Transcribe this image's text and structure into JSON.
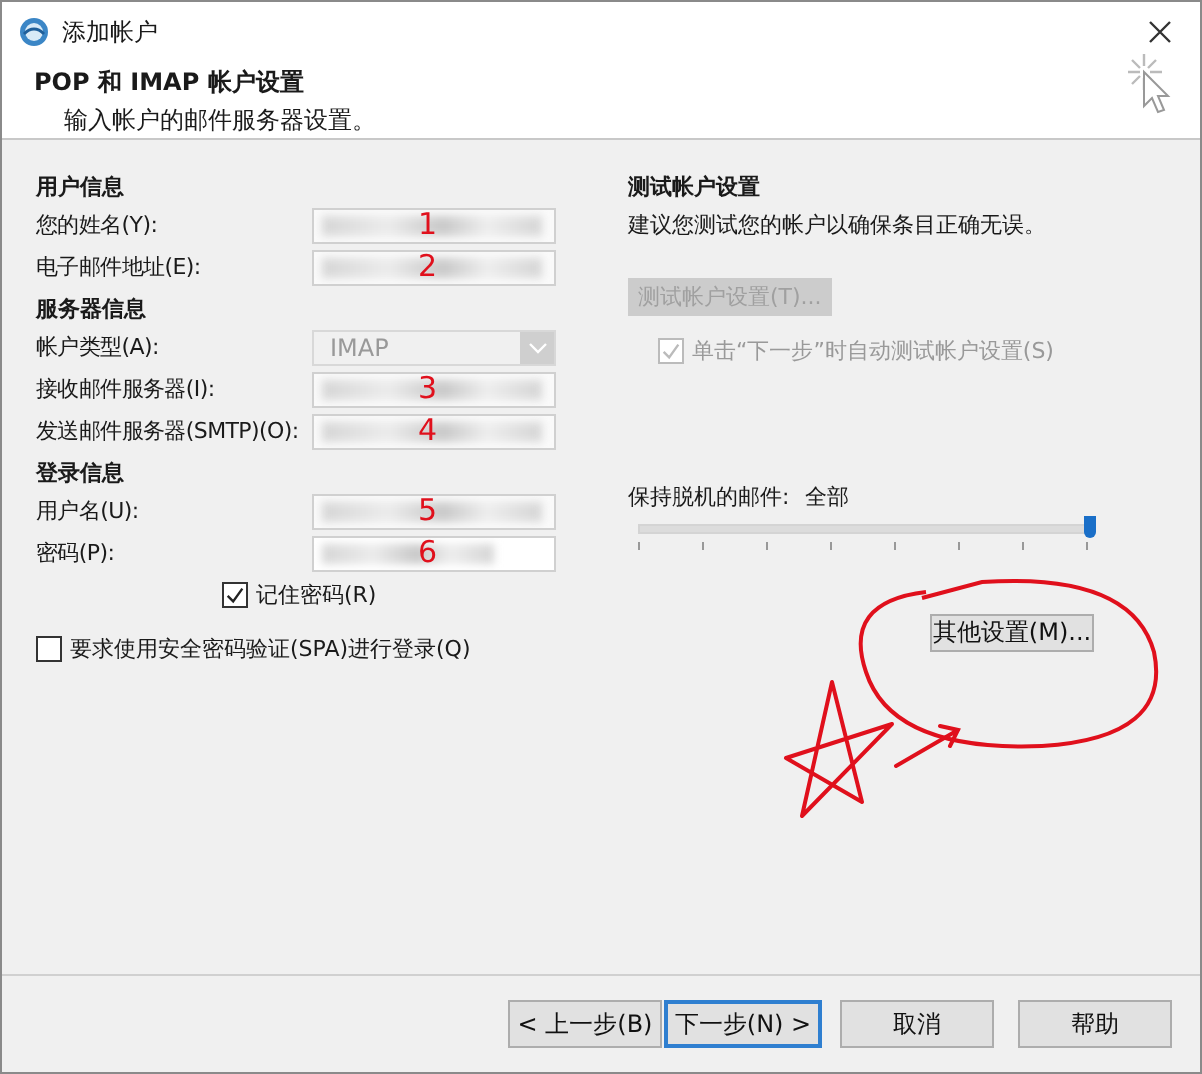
{
  "window": {
    "title": "添加帐户"
  },
  "header": {
    "title": "POP 和 IMAP 帐户设置",
    "subtitle": "输入帐户的邮件服务器设置。"
  },
  "sections": [
    {
      "heading": "用户信息",
      "fields": [
        {
          "kind": "text",
          "label": "您的姓名(Y):",
          "annotation": "1"
        },
        {
          "kind": "text",
          "label": "电子邮件地址(E):",
          "annotation": "2"
        }
      ]
    },
    {
      "heading": "服务器信息",
      "fields": [
        {
          "kind": "combo",
          "label": "帐户类型(A):",
          "value": "IMAP",
          "disabled": true
        },
        {
          "kind": "text",
          "label": "接收邮件服务器(I):",
          "annotation": "3"
        },
        {
          "kind": "text",
          "label": "发送邮件服务器(SMTP)(O):",
          "annotation": "4"
        }
      ]
    },
    {
      "heading": "登录信息",
      "fields": [
        {
          "kind": "text",
          "label": "用户名(U):",
          "annotation": "5"
        },
        {
          "kind": "password",
          "label": "密码(P):",
          "annotation": "6"
        }
      ]
    }
  ],
  "remember_password": {
    "label": "记住密码(R)",
    "checked": true
  },
  "spa": {
    "label": "要求使用安全密码验证(SPA)进行登录(Q)",
    "checked": false
  },
  "test": {
    "heading": "测试帐户设置",
    "description": "建议您测试您的帐户以确保条目正确无误。",
    "button": {
      "label": "测试帐户设置(T)...",
      "disabled": true
    },
    "auto_test": {
      "label": "单击“下一步”时自动测试帐户设置(S)",
      "checked": true,
      "disabled": true
    }
  },
  "offline": {
    "label": "保持脱机的邮件:",
    "value": "全部",
    "level": 1
  },
  "more_settings": {
    "label": "其他设置(M)..."
  },
  "buttons": [
    {
      "label": "< 上一步(B)",
      "default": false
    },
    {
      "label": "下一步(N) >",
      "default": true
    },
    {
      "label": "取消",
      "default": false
    },
    {
      "label": "帮助",
      "default": false
    }
  ]
}
